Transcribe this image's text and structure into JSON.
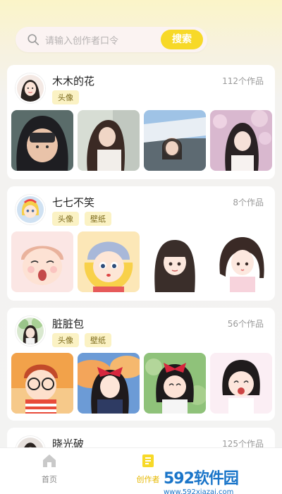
{
  "search": {
    "placeholder": "请输入创作者口令",
    "button": "搜索"
  },
  "creators": [
    {
      "name": "木木的花",
      "count": "112个作品",
      "tags": [
        "头像"
      ]
    },
    {
      "name": "七七不笑",
      "count": "8个作品",
      "tags": [
        "头像",
        "壁纸"
      ]
    },
    {
      "name": "脏脏包",
      "count": "56个作品",
      "tags": [
        "头像",
        "壁纸"
      ]
    },
    {
      "name": "晓光破",
      "count": "125个作品",
      "tags": []
    }
  ],
  "nav": {
    "home": "首页",
    "creator": "创作者"
  },
  "colors": {
    "accent": "#f7d928",
    "nav_active": "#e6b800",
    "nav_home": "#888888"
  },
  "watermark": {
    "brand": "592软件园",
    "url": "www.592xiazai.com"
  }
}
